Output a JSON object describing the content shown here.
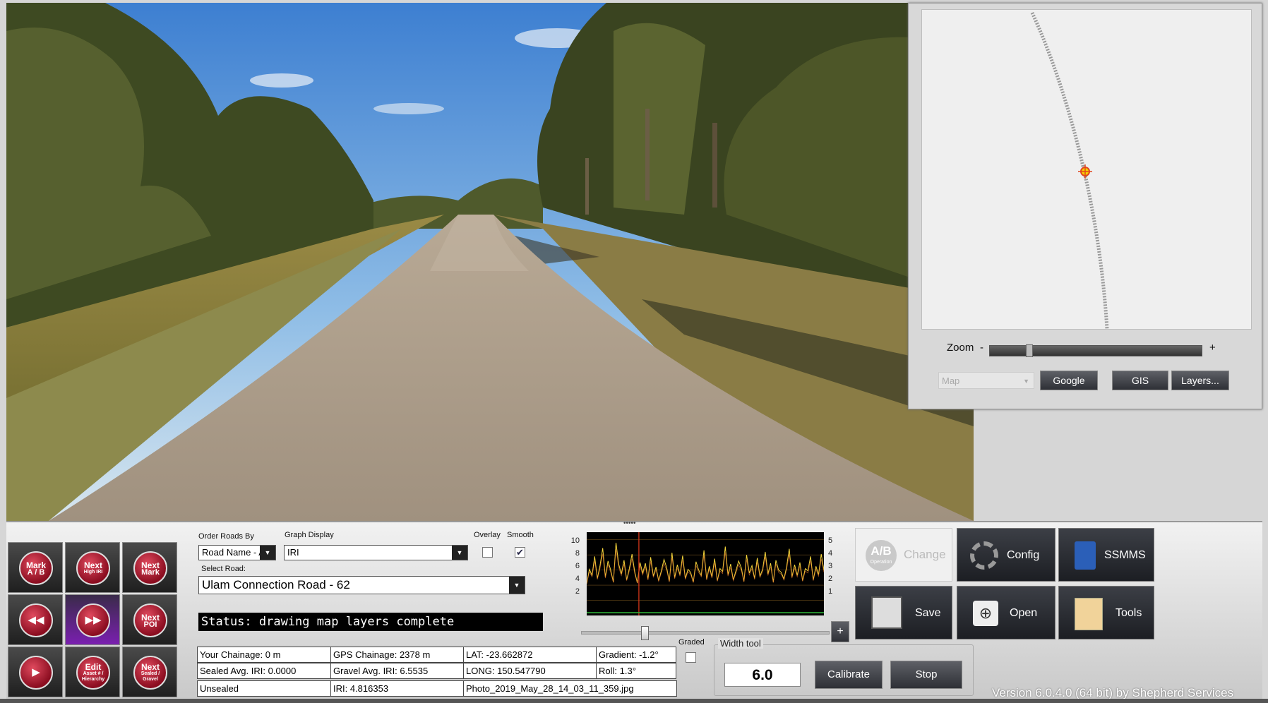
{
  "map": {
    "zoom_label": "Zoom",
    "zoom_minus": "-",
    "zoom_plus": "+",
    "zoom_level": 0.17,
    "map_select_value": "Map",
    "google_button": "Google",
    "gis_button": "GIS",
    "layers_button": "Layers..."
  },
  "controls": {
    "order_roads_label": "Order Roads By",
    "order_roads_value": "Road Name - A",
    "graph_display_label": "Graph Display",
    "graph_display_value": "IRI",
    "overlay_label": "Overlay",
    "overlay_checked": false,
    "smooth_label": "Smooth",
    "smooth_checked": true,
    "select_road_label": "Select Road:",
    "select_road_value": "Ulam Connection Road - 62",
    "status_text": "Status: drawing map layers complete"
  },
  "nav_buttons": [
    {
      "line1": "Mark",
      "line2": "A / B"
    },
    {
      "line1": "Next",
      "line2": "High IRI"
    },
    {
      "line1": "Next",
      "line2": "Mark"
    },
    {
      "line1": "◀◀",
      "line2": ""
    },
    {
      "line1": "▶▶",
      "line2": ""
    },
    {
      "line1": "Next",
      "line2": "POI"
    },
    {
      "line1": "▶",
      "line2": ""
    },
    {
      "line1": "Edit",
      "line2": "Asset # / Hierarchy"
    },
    {
      "line1": "Next",
      "line2": "Sealed / Gravel"
    }
  ],
  "info_table": [
    [
      "Your Chainage: 0 m",
      "GPS Chainage: 2378 m",
      "LAT: -23.662872",
      "Gradient: -1.2°"
    ],
    [
      "Sealed Avg. IRI: 0.0000",
      "Gravel Avg. IRI: 6.5535",
      "LONG: 150.547790",
      "Roll: 1.3°"
    ],
    [
      "Unsealed",
      "IRI: 4.816353",
      "Photo_2019_May_28_14_03_11_359.jpg",
      ""
    ]
  ],
  "graded_label": "Graded",
  "graded_checked": false,
  "width_tool": {
    "title": "Width tool",
    "value": "6.0",
    "calibrate_button": "Calibrate",
    "stop_button": "Stop"
  },
  "graph": {
    "plus_button": "+",
    "left_axis": [
      "10",
      "8",
      "6",
      "4",
      "2"
    ],
    "right_axis": [
      "5",
      "4",
      "3",
      "2",
      "1"
    ],
    "slider_position": 0.25
  },
  "chart_data": {
    "type": "line",
    "left_yticks": [
      2,
      4,
      6,
      8,
      10
    ],
    "right_yticks": [
      1,
      2,
      3,
      4,
      5
    ],
    "series": [
      {
        "values": [
          4.2,
          6.1,
          5.3,
          7.8,
          4.9,
          6.6,
          8.9,
          5.1,
          7.2,
          6.0,
          4.4,
          9.6,
          6.8,
          5.5,
          7.3,
          4.7,
          6.2,
          8.1,
          5.8,
          4.3,
          7.0,
          5.6,
          6.9,
          4.8,
          7.7,
          5.2,
          6.4,
          4.6,
          5.9,
          7.4,
          6.3,
          4.5,
          8.3,
          5.0,
          6.7,
          5.4,
          7.9,
          4.9,
          6.1,
          5.7,
          4.4,
          7.1,
          6.0,
          5.3,
          8.6,
          4.8,
          6.5,
          5.1,
          7.5,
          4.6,
          6.2,
          5.8,
          9.1,
          5.4,
          6.8,
          4.7,
          5.9,
          7.2,
          6.3,
          4.5,
          8.0,
          5.6,
          6.6,
          4.9,
          7.6,
          5.2,
          6.1,
          8.4,
          5.5,
          6.9,
          4.4,
          7.3,
          6.0,
          5.7,
          4.8,
          6.4,
          8.8,
          5.1,
          6.7,
          5.3,
          7.0,
          4.6,
          6.2,
          5.9,
          7.8,
          4.7,
          6.5,
          5.4,
          8.1,
          6.0
        ]
      }
    ],
    "marker_x_fraction": 0.22
  },
  "right_buttons": {
    "change": {
      "badge_main": "A/B",
      "badge_sub": "Operation",
      "label": "Change"
    },
    "config": "Config",
    "ssmms": "SSMMS",
    "save": "Save",
    "open": "Open",
    "tools": "Tools"
  },
  "version_text": "Version 6.0.4.0 (64 bit) by Shepherd Services"
}
